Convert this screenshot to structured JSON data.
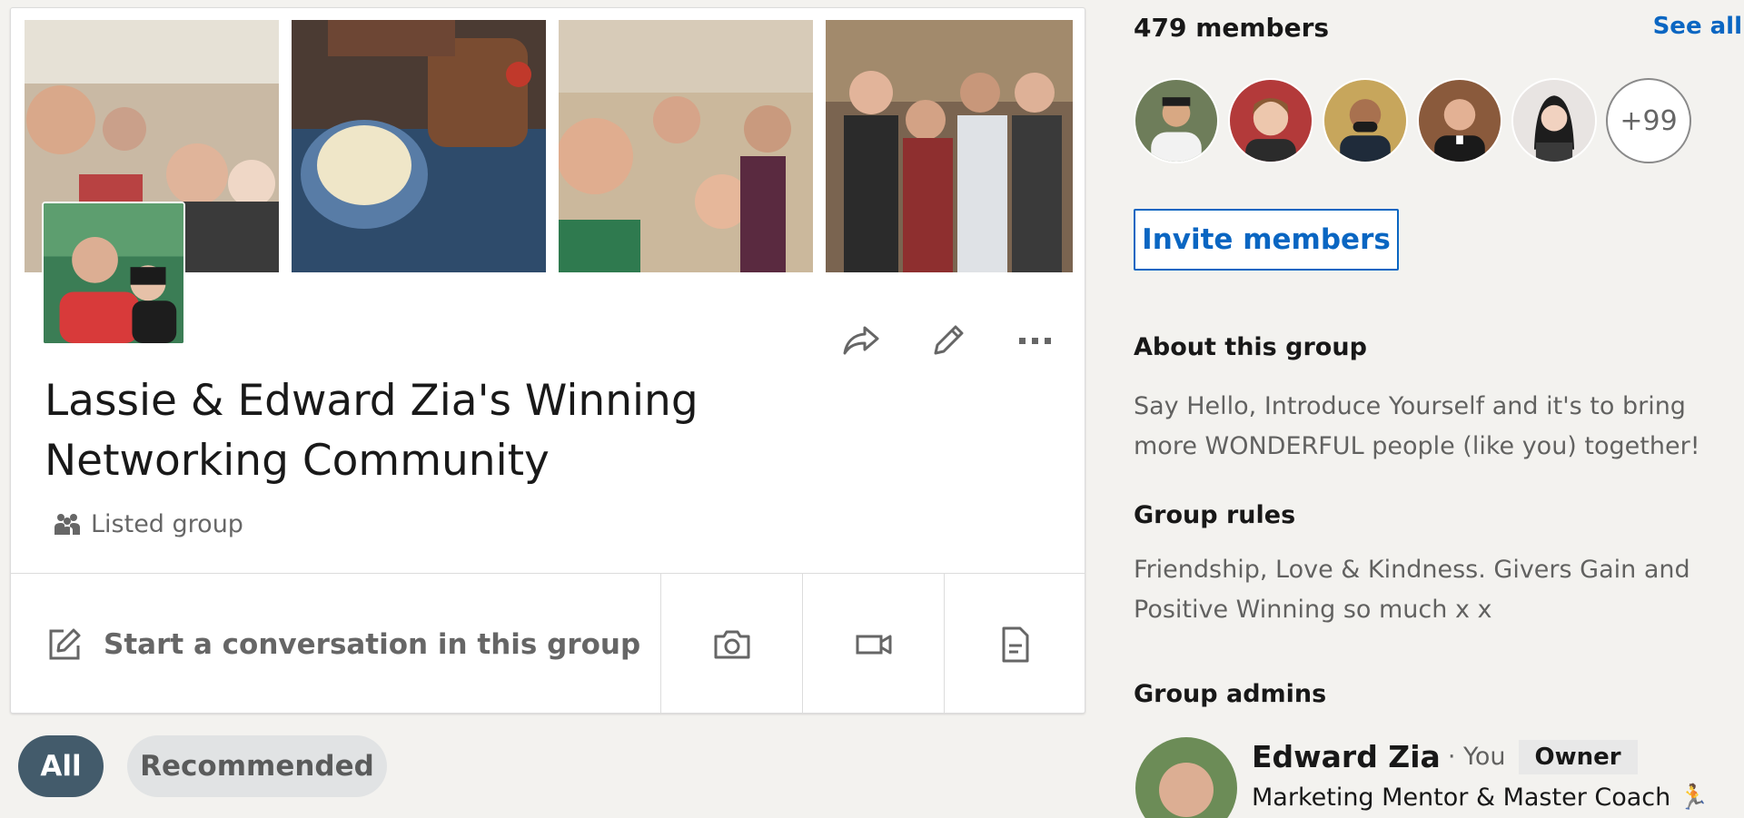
{
  "group": {
    "title": "Lassie & Edward Zia's Winning Networking Community",
    "type_label": "Listed group",
    "icons": {
      "share": "share-icon",
      "edit": "pencil-icon",
      "more": "more-dots-icon",
      "type": "group-people-icon"
    }
  },
  "composer": {
    "start_label": "Start a conversation in this group",
    "icons": [
      "compose-icon",
      "camera-icon",
      "video-icon",
      "document-icon"
    ]
  },
  "filters": [
    {
      "label": "All",
      "active": true
    },
    {
      "label": "Recommended",
      "active": false
    }
  ],
  "sidebar": {
    "members_count": "479 members",
    "see_all": "See all",
    "more_members": "+99",
    "invite_label": "Invite members",
    "about": {
      "heading": "About this group",
      "text": "Say Hello, Introduce Yourself and it's to bring more WONDERFUL people (like you) together!"
    },
    "rules": {
      "heading": "Group rules",
      "text": "Friendship, Love & Kindness. Givers Gain and Positive Winning so much x x"
    },
    "admins": {
      "heading": "Group admins",
      "list": [
        {
          "name": "Edward Zia",
          "you_label": "· You",
          "badge": "Owner",
          "headline": "Marketing Mentor & Master Coach 🏃"
        }
      ]
    }
  },
  "colors": {
    "accent": "#0a66c2",
    "pill_active": "#435b6b",
    "background": "#f3f2ef"
  }
}
